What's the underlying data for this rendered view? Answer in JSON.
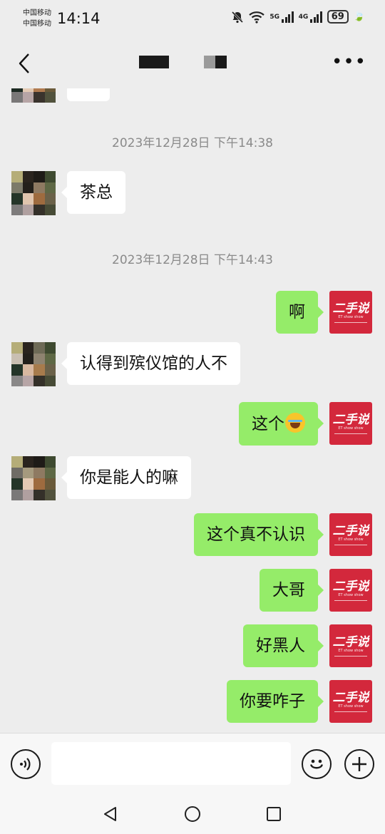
{
  "status_bar": {
    "carrier_1": "中国移动",
    "carrier_2": "中国移动",
    "time": "14:14",
    "net_1": "5G",
    "net_2": "4G",
    "battery": "69"
  },
  "header": {
    "title_redacted": true
  },
  "chat": {
    "timestamps": [
      "2023年12月28日 下午14:38",
      "2023年12月28日 下午14:43"
    ],
    "messages": [
      {
        "side": "left",
        "text": "茶总"
      },
      {
        "side": "right",
        "text": "啊"
      },
      {
        "side": "left",
        "text": "认得到殡仪馆的人不"
      },
      {
        "side": "right",
        "text": "这个",
        "emoji": "tears-of-joy-emoji"
      },
      {
        "side": "left",
        "text": "你是能人的嘛"
      },
      {
        "side": "right",
        "text": "这个真不认识"
      },
      {
        "side": "right",
        "text": "大哥"
      },
      {
        "side": "right",
        "text": "好黑人"
      },
      {
        "side": "right",
        "text": "你要咋子"
      }
    ],
    "self_avatar": {
      "logo_text": "二手说",
      "logo_sub": "ET show show",
      "color": "#d3283c"
    }
  },
  "input": {
    "value": "",
    "placeholder": ""
  },
  "colors": {
    "background": "#ededed",
    "sent_bubble": "#95ec69",
    "received_bubble": "#ffffff"
  },
  "icons": [
    "back-icon",
    "more-icon",
    "voice-icon",
    "emoji-icon",
    "plus-icon",
    "nav-back-icon",
    "nav-home-icon",
    "nav-recent-icon"
  ]
}
